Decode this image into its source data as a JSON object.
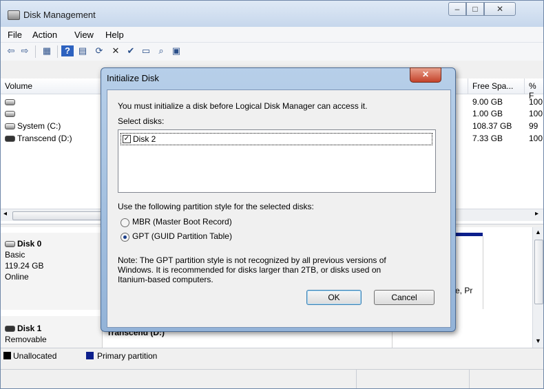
{
  "window": {
    "title": "Disk Management"
  },
  "caption_buttons": {
    "minimize": "–",
    "maximize": "□",
    "close": "✕"
  },
  "menu": [
    "File",
    "Action",
    "View",
    "Help"
  ],
  "volume_list": {
    "columns": [
      "Volume",
      "Free Spa...",
      "% F"
    ],
    "rows": [
      {
        "volume": "",
        "free": "9.00 GB",
        "pct": "100"
      },
      {
        "volume": "",
        "free": "1.00 GB",
        "pct": "100"
      },
      {
        "volume": "System (C:)",
        "free": "108.37 GB",
        "pct": "99"
      },
      {
        "volume": "Transcend (D:)",
        "free": "7.33 GB",
        "pct": "100"
      }
    ]
  },
  "disks": [
    {
      "name": "Disk 0",
      "type": "Basic",
      "size": "119.24 GB",
      "status": "Online",
      "partial_label": "e, Pr"
    },
    {
      "name": "Disk 1",
      "type": "Removable",
      "partition": "Transcend (D:)"
    }
  ],
  "legend": {
    "unallocated": "Unallocated",
    "primary": "Primary partition",
    "unallocated_color": "#000000",
    "primary_color": "#0c1f8c"
  },
  "dialog": {
    "title": "Initialize Disk",
    "close": "✕",
    "message": "You must initialize a disk before Logical Disk Manager can access it.",
    "select_label": "Select disks:",
    "disks": [
      {
        "label": "Disk 2",
        "checked": true
      }
    ],
    "style_label": "Use the following partition style for the selected disks:",
    "options": [
      {
        "label": "MBR (Master Boot Record)",
        "selected": false
      },
      {
        "label": "GPT (GUID Partition Table)",
        "selected": true
      }
    ],
    "note_lines": [
      "Note: The GPT partition style is not recognized by all previous versions of",
      "Windows. It is recommended for disks larger than 2TB, or disks used on",
      "Itanium-based computers."
    ],
    "ok": "OK",
    "cancel": "Cancel"
  }
}
